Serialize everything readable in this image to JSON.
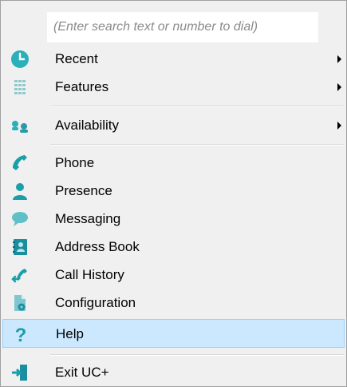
{
  "search": {
    "placeholder": "(Enter search text or number to dial)"
  },
  "menu": {
    "items": [
      {
        "label": "Recent",
        "icon": "clock-icon",
        "has_submenu": true
      },
      {
        "label": "Features",
        "icon": "keypad-icon",
        "has_submenu": true
      },
      {
        "label": "Availability",
        "icon": "availability-icon",
        "has_submenu": true
      },
      {
        "label": "Phone",
        "icon": "phone-icon"
      },
      {
        "label": "Presence",
        "icon": "person-icon"
      },
      {
        "label": "Messaging",
        "icon": "chat-bubble-icon"
      },
      {
        "label": "Address Book",
        "icon": "address-book-icon"
      },
      {
        "label": "Call History",
        "icon": "call-history-icon"
      },
      {
        "label": "Configuration",
        "icon": "configuration-icon"
      },
      {
        "label": "Help",
        "icon": "question-mark-icon",
        "highlighted": true
      },
      {
        "label": "Exit UC+",
        "icon": "exit-door-icon"
      }
    ]
  },
  "colors": {
    "accent": "#1aa8a8",
    "highlight_bg": "#cce8ff",
    "highlight_border": "#99d1ff",
    "menu_bg": "#f0f0f0"
  }
}
